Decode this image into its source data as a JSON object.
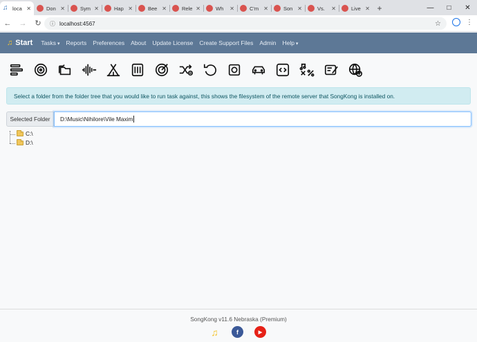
{
  "browser": {
    "tabs": [
      {
        "label": "loca",
        "active": true
      },
      {
        "label": "Don",
        "active": false
      },
      {
        "label": "Sym",
        "active": false
      },
      {
        "label": "Hap",
        "active": false
      },
      {
        "label": "Bee",
        "active": false
      },
      {
        "label": "Rele",
        "active": false
      },
      {
        "label": "Wh",
        "active": false
      },
      {
        "label": "C'm",
        "active": false
      },
      {
        "label": "Son",
        "active": false
      },
      {
        "label": "Vs.",
        "active": false
      },
      {
        "label": "Live",
        "active": false
      }
    ],
    "url": "localhost:4567",
    "icons": {
      "back": "back-arrow-icon",
      "forward": "forward-arrow-icon",
      "reload": "reload-icon",
      "star": "star-icon",
      "profile": "profile-icon",
      "menu": "kebab-menu-icon"
    }
  },
  "navbar": {
    "brand": "Start",
    "links": [
      "Tasks",
      "Reports",
      "Preferences",
      "About",
      "Update License",
      "Create Support Files",
      "Admin",
      "Help"
    ],
    "dropdowns": [
      true,
      false,
      false,
      false,
      false,
      false,
      false,
      true
    ]
  },
  "toolbar": {
    "icons": [
      "fix-songs-icon",
      "cd-icon",
      "folders-icon",
      "audio-waveform-icon",
      "tent-icon",
      "calculator-icon",
      "target-icon",
      "shuffle-icon",
      "undo-icon",
      "square-box-icon",
      "car-icon",
      "code-icon",
      "music-percent-icon",
      "edit-list-icon",
      "globe-upload-icon"
    ]
  },
  "alert": {
    "text": "Select a folder from the folder tree that you would like to run task against, this shows the filesystem of the remote server that SongKong is installed on."
  },
  "folder_input": {
    "label": "Selected Folder",
    "value": "D:\\Music\\Nihilore\\Vile Maxim"
  },
  "tree": {
    "nodes": [
      "C:\\",
      "D:\\"
    ]
  },
  "footer": {
    "text": "SongKong v11.6 Nebraska (Premium)",
    "social": [
      "songkong-logo-icon",
      "facebook-icon",
      "youtube-icon"
    ]
  },
  "colors": {
    "navbar": "#5d7896",
    "alert_bg": "#d1ecf1",
    "alert_text": "#0c5460"
  }
}
